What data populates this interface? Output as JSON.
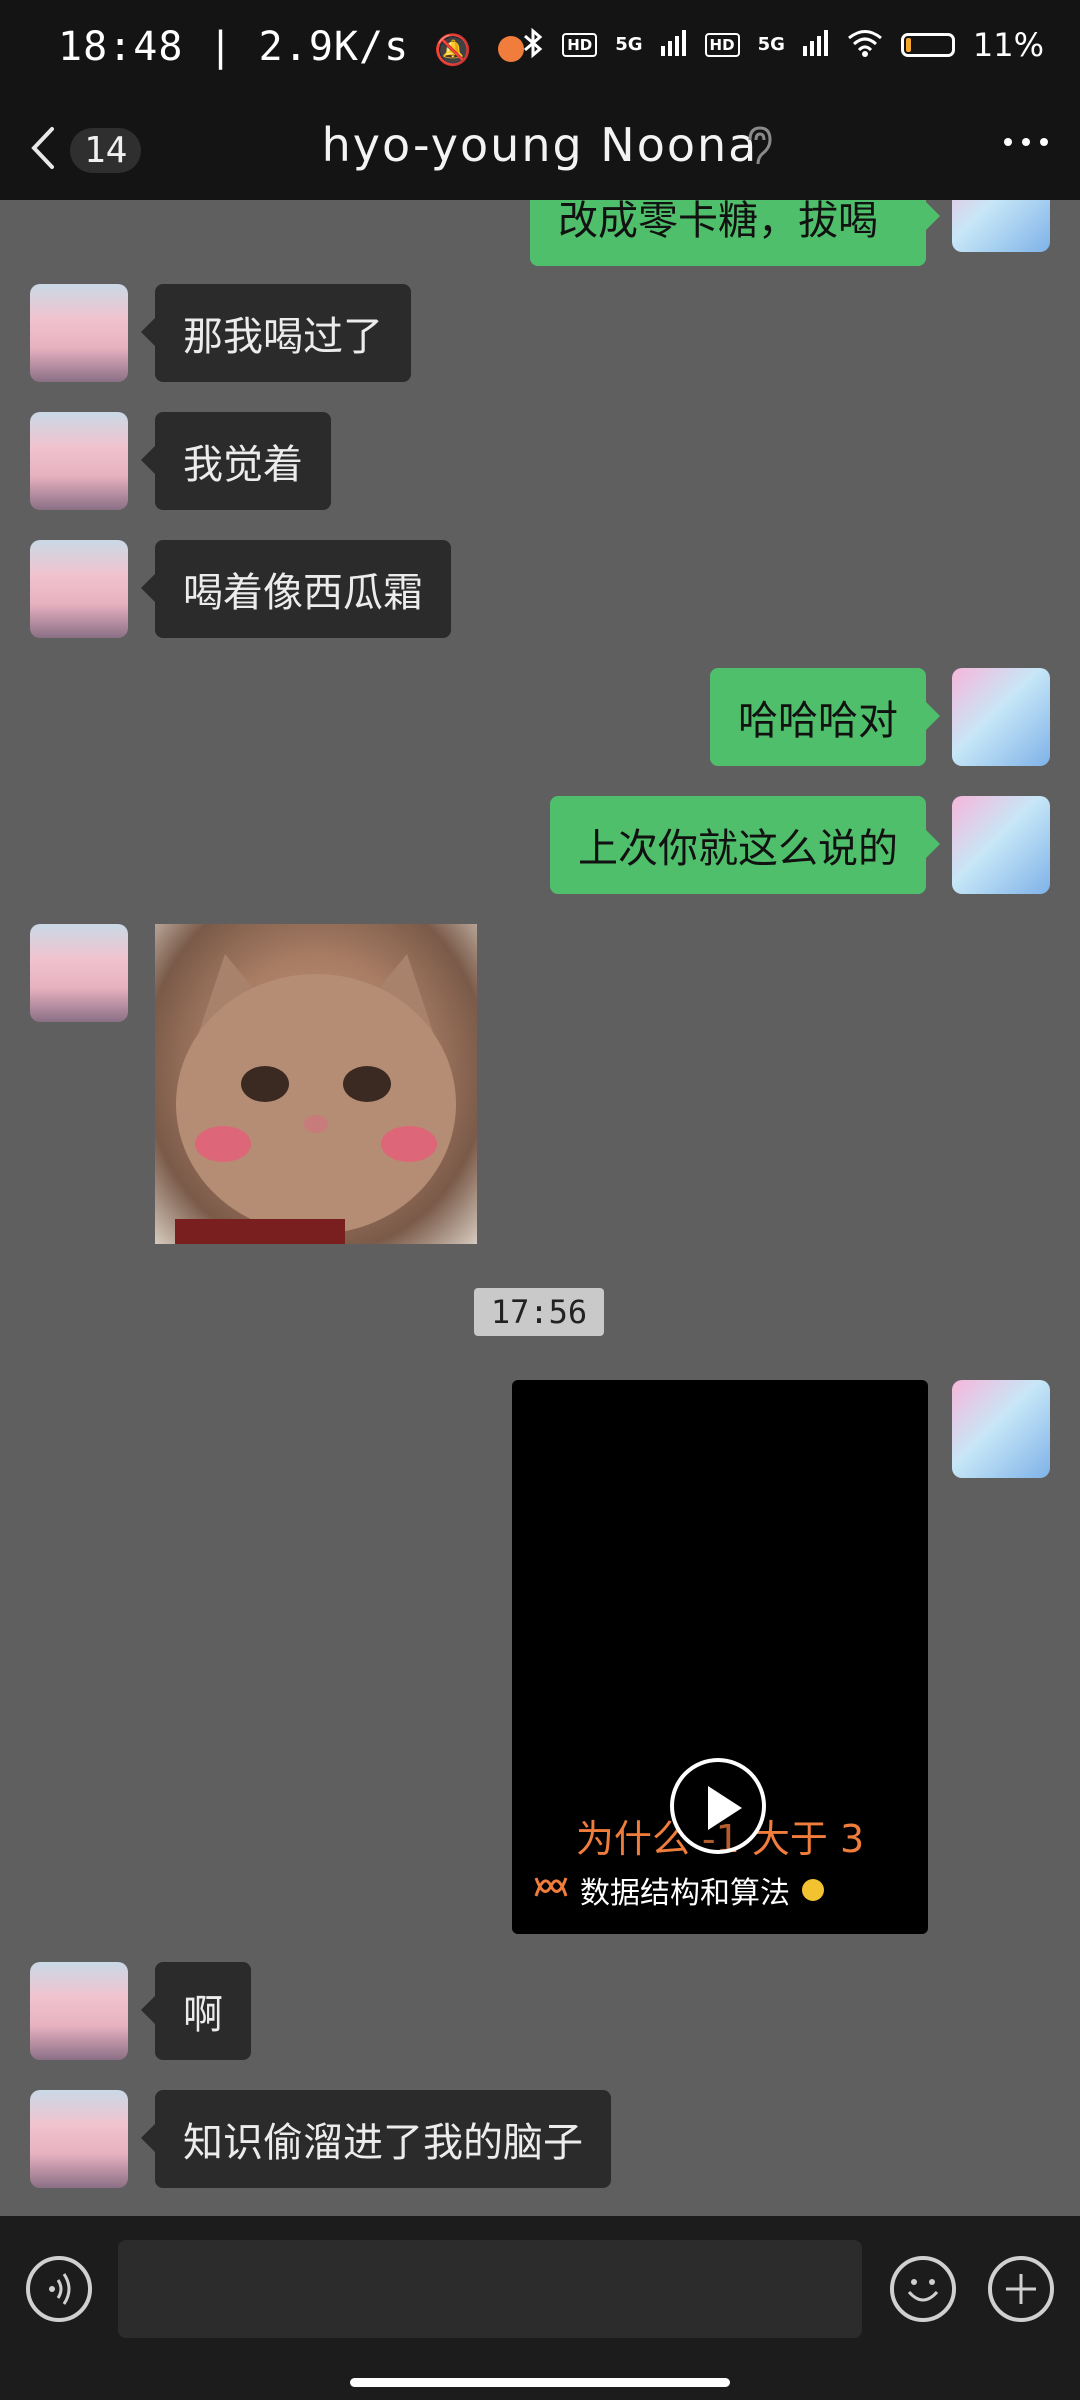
{
  "status_bar": {
    "time": "18:48",
    "net_speed": "2.9K/s",
    "hd1": "HD",
    "hd2": "HD",
    "sig1": "5G",
    "sig2": "5G",
    "battery_pct_text": "11%",
    "battery_level": 0.11,
    "battery_color": "#f2a62a"
  },
  "header": {
    "back_icon": "chevron-left-icon",
    "unread_count": "14",
    "title": "hyo-young Noona",
    "mute_icon": "ear-icon",
    "more_icon": "more-dots-icon"
  },
  "messages": {
    "partial_out": "改成零卡糖，拔喝",
    "m1": "那我喝过了",
    "m2": "我觉着",
    "m3": "喝着像西瓜霜",
    "m4": "哈哈哈对",
    "m5": "上次你就这么说的",
    "timestamp": "17:56",
    "video": {
      "overlay_text": "为什么 -1 大于 3",
      "source": "数据结构和算法",
      "play_icon": "play-icon"
    },
    "m6": "啊",
    "m7": "知识偷溜进了我的脑子"
  },
  "input_bar": {
    "voice_icon": "voice-icon",
    "placeholder": "",
    "emoji_icon": "emoji-icon",
    "plus_icon": "plus-icon"
  },
  "colors": {
    "chat_bg": "#5f5f5f",
    "incoming_bubble": "#2b2b2b",
    "outgoing_bubble": "#4fbf6b",
    "video_text": "#f07d3b"
  }
}
